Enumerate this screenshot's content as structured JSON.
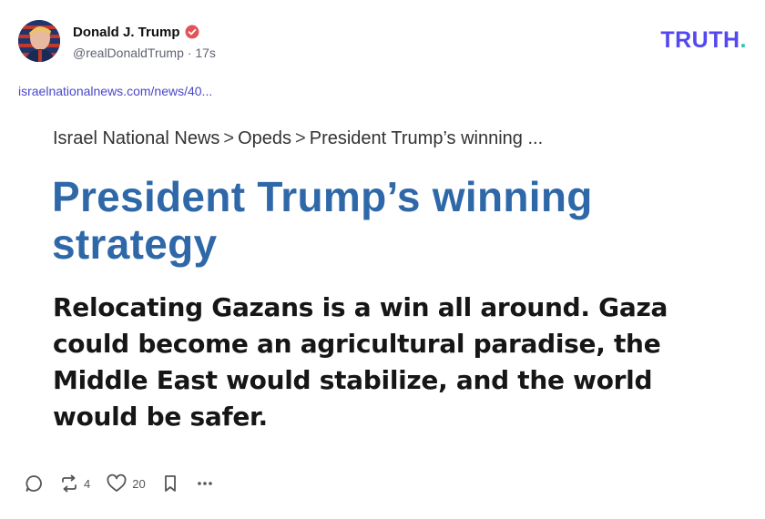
{
  "post": {
    "author_name": "Donald J. Trump",
    "handle": "@realDonaldTrump",
    "separator": "·",
    "timestamp": "17s",
    "verified_icon": "verified-badge-icon",
    "link_text": "israelnationalnews.com/news/40..."
  },
  "brand": {
    "name": "TRUTH",
    "dot": ".",
    "colors": {
      "text": "#5448ee",
      "dot": "#2cc4b6"
    }
  },
  "card": {
    "breadcrumb": [
      "Israel National News",
      ">",
      "Opeds",
      ">",
      "President Trump’s winning ..."
    ],
    "headline": "President Trump’s winning strategy",
    "subhead": "Relocating Gazans is a win all around. Gaza could become an agricultural paradise, the Middle East would stabilize, and the world would be safer.",
    "colors": {
      "headline": "#2f68a8",
      "subhead": "#161616"
    }
  },
  "actions": {
    "reply_icon": "reply-icon",
    "retruth_icon": "retruth-icon",
    "retruth_count": "4",
    "like_icon": "heart-icon",
    "like_count": "20",
    "bookmark_icon": "bookmark-icon",
    "more_icon": "more-icon"
  }
}
